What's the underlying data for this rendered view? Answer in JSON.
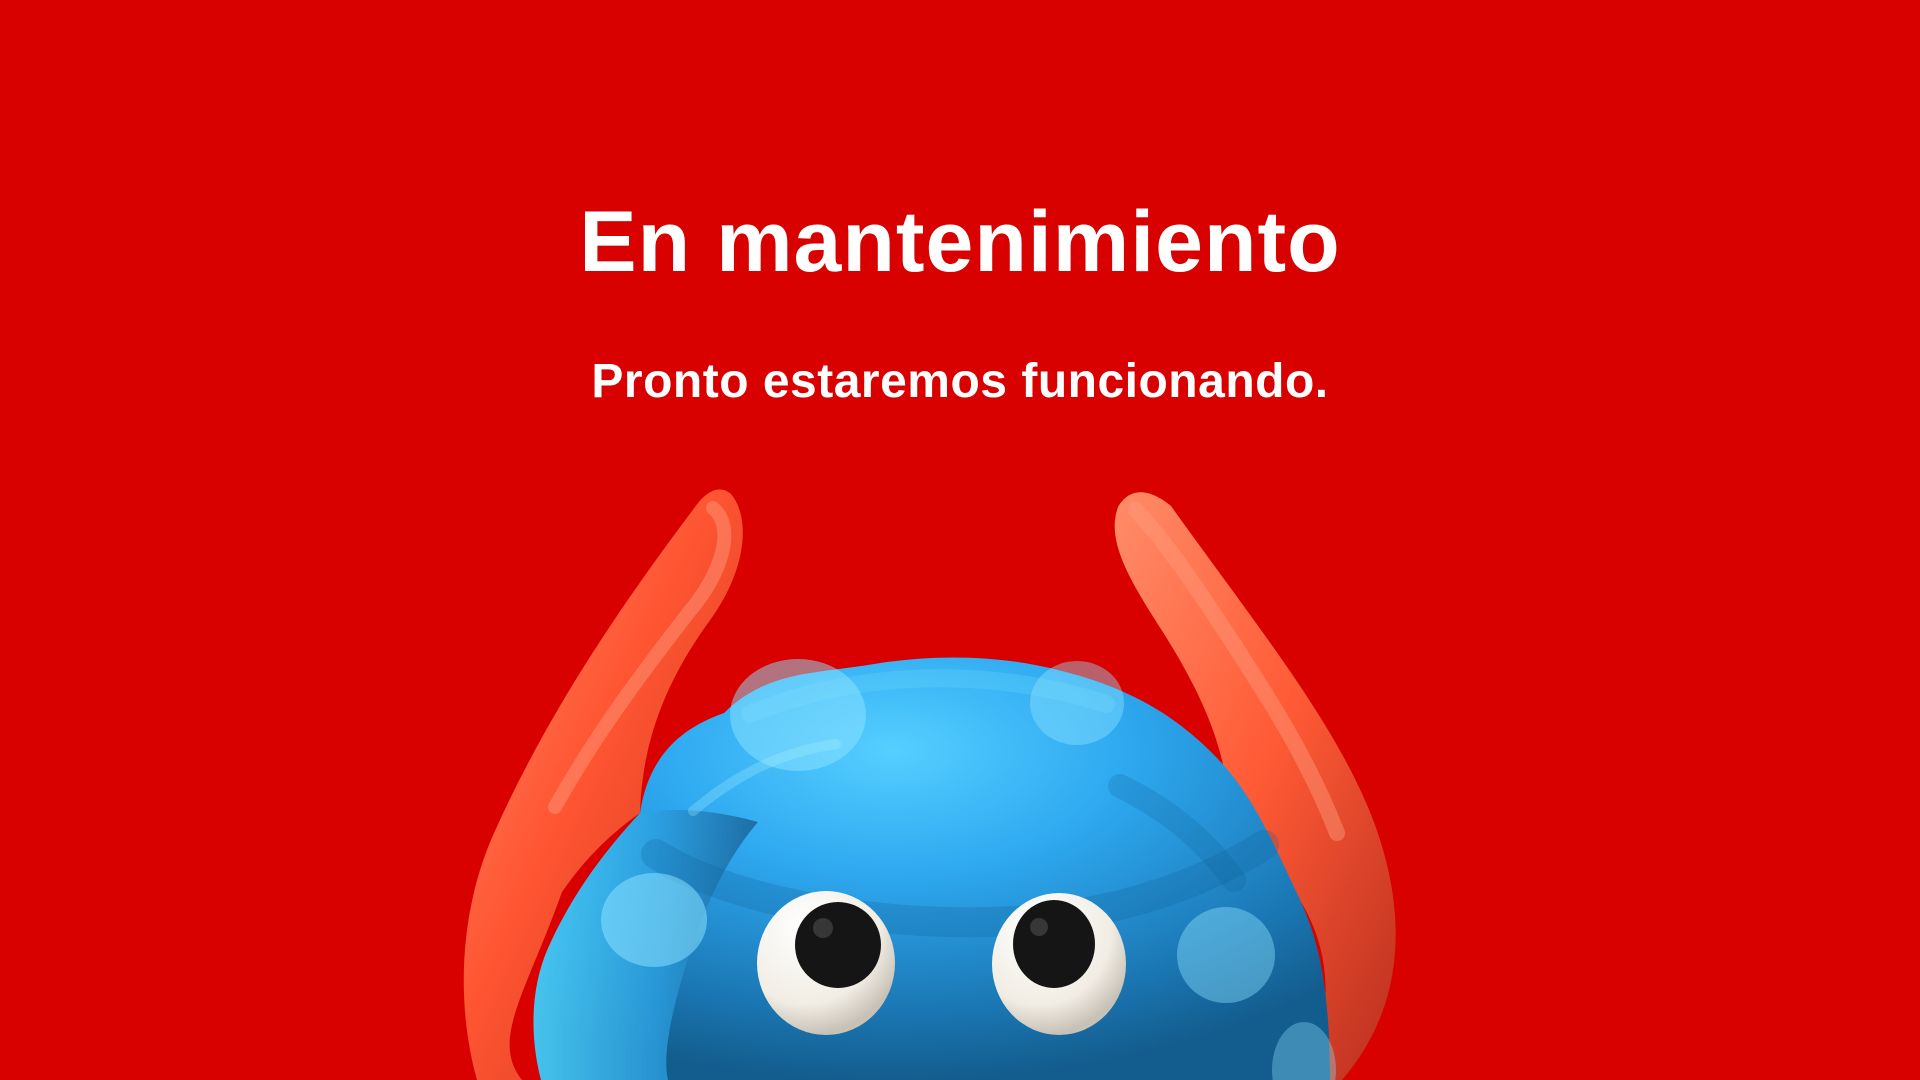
{
  "page": {
    "title": "En mantenimiento",
    "subtitle": "Pronto estaremos funcionando.",
    "mascot": "horned-blue-monster-mascot",
    "colors": {
      "background": "#d90000",
      "text": "#ffffff",
      "mascot_body": "#33b6f5",
      "mascot_horns": "#ff5c35",
      "mascot_spots": "#8ee4ff",
      "eye_white": "#f3efe6",
      "pupil": "#151515"
    }
  }
}
